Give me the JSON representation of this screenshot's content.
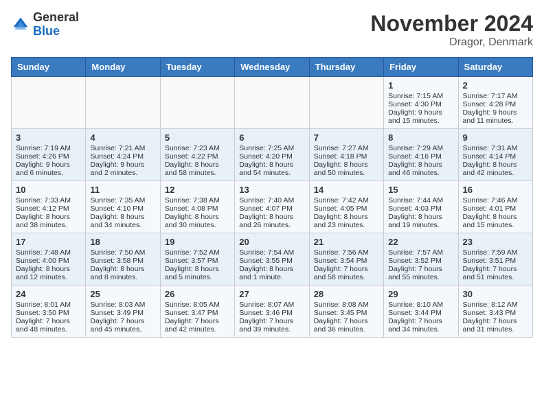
{
  "header": {
    "logo_line1": "General",
    "logo_line2": "Blue",
    "month": "November 2024",
    "location": "Dragor, Denmark"
  },
  "weekdays": [
    "Sunday",
    "Monday",
    "Tuesday",
    "Wednesday",
    "Thursday",
    "Friday",
    "Saturday"
  ],
  "weeks": [
    [
      {
        "day": "",
        "sunrise": "",
        "sunset": "",
        "daylight": ""
      },
      {
        "day": "",
        "sunrise": "",
        "sunset": "",
        "daylight": ""
      },
      {
        "day": "",
        "sunrise": "",
        "sunset": "",
        "daylight": ""
      },
      {
        "day": "",
        "sunrise": "",
        "sunset": "",
        "daylight": ""
      },
      {
        "day": "",
        "sunrise": "",
        "sunset": "",
        "daylight": ""
      },
      {
        "day": "1",
        "sunrise": "Sunrise: 7:15 AM",
        "sunset": "Sunset: 4:30 PM",
        "daylight": "Daylight: 9 hours and 15 minutes."
      },
      {
        "day": "2",
        "sunrise": "Sunrise: 7:17 AM",
        "sunset": "Sunset: 4:28 PM",
        "daylight": "Daylight: 9 hours and 11 minutes."
      }
    ],
    [
      {
        "day": "3",
        "sunrise": "Sunrise: 7:19 AM",
        "sunset": "Sunset: 4:26 PM",
        "daylight": "Daylight: 9 hours and 6 minutes."
      },
      {
        "day": "4",
        "sunrise": "Sunrise: 7:21 AM",
        "sunset": "Sunset: 4:24 PM",
        "daylight": "Daylight: 9 hours and 2 minutes."
      },
      {
        "day": "5",
        "sunrise": "Sunrise: 7:23 AM",
        "sunset": "Sunset: 4:22 PM",
        "daylight": "Daylight: 8 hours and 58 minutes."
      },
      {
        "day": "6",
        "sunrise": "Sunrise: 7:25 AM",
        "sunset": "Sunset: 4:20 PM",
        "daylight": "Daylight: 8 hours and 54 minutes."
      },
      {
        "day": "7",
        "sunrise": "Sunrise: 7:27 AM",
        "sunset": "Sunset: 4:18 PM",
        "daylight": "Daylight: 8 hours and 50 minutes."
      },
      {
        "day": "8",
        "sunrise": "Sunrise: 7:29 AM",
        "sunset": "Sunset: 4:16 PM",
        "daylight": "Daylight: 8 hours and 46 minutes."
      },
      {
        "day": "9",
        "sunrise": "Sunrise: 7:31 AM",
        "sunset": "Sunset: 4:14 PM",
        "daylight": "Daylight: 8 hours and 42 minutes."
      }
    ],
    [
      {
        "day": "10",
        "sunrise": "Sunrise: 7:33 AM",
        "sunset": "Sunset: 4:12 PM",
        "daylight": "Daylight: 8 hours and 38 minutes."
      },
      {
        "day": "11",
        "sunrise": "Sunrise: 7:35 AM",
        "sunset": "Sunset: 4:10 PM",
        "daylight": "Daylight: 8 hours and 34 minutes."
      },
      {
        "day": "12",
        "sunrise": "Sunrise: 7:38 AM",
        "sunset": "Sunset: 4:08 PM",
        "daylight": "Daylight: 8 hours and 30 minutes."
      },
      {
        "day": "13",
        "sunrise": "Sunrise: 7:40 AM",
        "sunset": "Sunset: 4:07 PM",
        "daylight": "Daylight: 8 hours and 26 minutes."
      },
      {
        "day": "14",
        "sunrise": "Sunrise: 7:42 AM",
        "sunset": "Sunset: 4:05 PM",
        "daylight": "Daylight: 8 hours and 23 minutes."
      },
      {
        "day": "15",
        "sunrise": "Sunrise: 7:44 AM",
        "sunset": "Sunset: 4:03 PM",
        "daylight": "Daylight: 8 hours and 19 minutes."
      },
      {
        "day": "16",
        "sunrise": "Sunrise: 7:46 AM",
        "sunset": "Sunset: 4:01 PM",
        "daylight": "Daylight: 8 hours and 15 minutes."
      }
    ],
    [
      {
        "day": "17",
        "sunrise": "Sunrise: 7:48 AM",
        "sunset": "Sunset: 4:00 PM",
        "daylight": "Daylight: 8 hours and 12 minutes."
      },
      {
        "day": "18",
        "sunrise": "Sunrise: 7:50 AM",
        "sunset": "Sunset: 3:58 PM",
        "daylight": "Daylight: 8 hours and 8 minutes."
      },
      {
        "day": "19",
        "sunrise": "Sunrise: 7:52 AM",
        "sunset": "Sunset: 3:57 PM",
        "daylight": "Daylight: 8 hours and 5 minutes."
      },
      {
        "day": "20",
        "sunrise": "Sunrise: 7:54 AM",
        "sunset": "Sunset: 3:55 PM",
        "daylight": "Daylight: 8 hours and 1 minute."
      },
      {
        "day": "21",
        "sunrise": "Sunrise: 7:56 AM",
        "sunset": "Sunset: 3:54 PM",
        "daylight": "Daylight: 7 hours and 58 minutes."
      },
      {
        "day": "22",
        "sunrise": "Sunrise: 7:57 AM",
        "sunset": "Sunset: 3:52 PM",
        "daylight": "Daylight: 7 hours and 55 minutes."
      },
      {
        "day": "23",
        "sunrise": "Sunrise: 7:59 AM",
        "sunset": "Sunset: 3:51 PM",
        "daylight": "Daylight: 7 hours and 51 minutes."
      }
    ],
    [
      {
        "day": "24",
        "sunrise": "Sunrise: 8:01 AM",
        "sunset": "Sunset: 3:50 PM",
        "daylight": "Daylight: 7 hours and 48 minutes."
      },
      {
        "day": "25",
        "sunrise": "Sunrise: 8:03 AM",
        "sunset": "Sunset: 3:49 PM",
        "daylight": "Daylight: 7 hours and 45 minutes."
      },
      {
        "day": "26",
        "sunrise": "Sunrise: 8:05 AM",
        "sunset": "Sunset: 3:47 PM",
        "daylight": "Daylight: 7 hours and 42 minutes."
      },
      {
        "day": "27",
        "sunrise": "Sunrise: 8:07 AM",
        "sunset": "Sunset: 3:46 PM",
        "daylight": "Daylight: 7 hours and 39 minutes."
      },
      {
        "day": "28",
        "sunrise": "Sunrise: 8:08 AM",
        "sunset": "Sunset: 3:45 PM",
        "daylight": "Daylight: 7 hours and 36 minutes."
      },
      {
        "day": "29",
        "sunrise": "Sunrise: 8:10 AM",
        "sunset": "Sunset: 3:44 PM",
        "daylight": "Daylight: 7 hours and 34 minutes."
      },
      {
        "day": "30",
        "sunrise": "Sunrise: 8:12 AM",
        "sunset": "Sunset: 3:43 PM",
        "daylight": "Daylight: 7 hours and 31 minutes."
      }
    ]
  ]
}
